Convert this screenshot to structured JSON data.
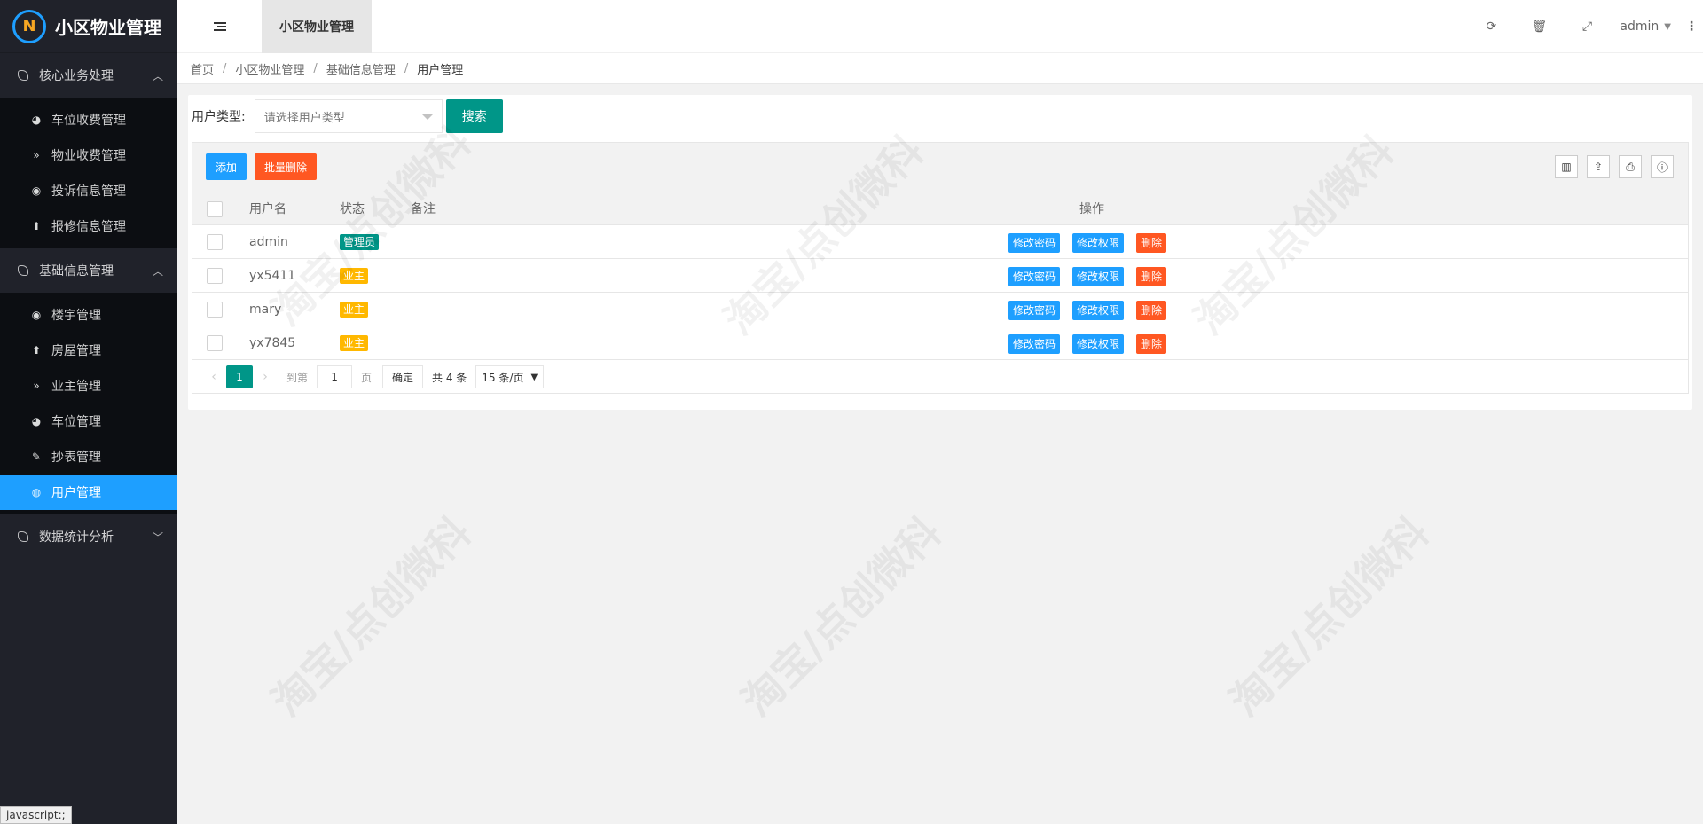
{
  "app": {
    "title": "小区物业管理",
    "logo_letter": "N"
  },
  "sidebar": {
    "groups": [
      {
        "label": "核心业务处理",
        "expanded": true,
        "items": [
          {
            "label": "车位收费管理",
            "icon": "dashboard-icon"
          },
          {
            "label": "物业收费管理",
            "icon": "double-chevron-icon"
          },
          {
            "label": "投诉信息管理",
            "icon": "target-icon"
          },
          {
            "label": "报修信息管理",
            "icon": "circle-up-icon"
          }
        ]
      },
      {
        "label": "基础信息管理",
        "expanded": true,
        "items": [
          {
            "label": "楼宇管理",
            "icon": "target-icon"
          },
          {
            "label": "房屋管理",
            "icon": "circle-up-icon"
          },
          {
            "label": "业主管理",
            "icon": "double-chevron-icon"
          },
          {
            "label": "车位管理",
            "icon": "dashboard-icon"
          },
          {
            "label": "抄表管理",
            "icon": "edit-icon"
          },
          {
            "label": "用户管理",
            "icon": "user-circle-icon",
            "active": true
          }
        ]
      },
      {
        "label": "数据统计分析",
        "expanded": false,
        "items": []
      }
    ],
    "status_tip": "javascript:;"
  },
  "header": {
    "active_tab": "小区物业管理",
    "user": "admin"
  },
  "breadcrumb": [
    "首页",
    "小区物业管理",
    "基础信息管理",
    "用户管理"
  ],
  "filter": {
    "label": "用户类型:",
    "placeholder": "请选择用户类型",
    "search_label": "搜索"
  },
  "toolbar": {
    "add_label": "添加",
    "batch_delete_label": "批量删除"
  },
  "table": {
    "columns": [
      "用户名",
      "状态",
      "备注",
      "操作"
    ],
    "rows": [
      {
        "username": "admin",
        "status": "管理员",
        "status_type": "admin"
      },
      {
        "username": "yx5411",
        "status": "业主",
        "status_type": "owner"
      },
      {
        "username": "mary",
        "status": "业主",
        "status_type": "owner"
      },
      {
        "username": "yx7845",
        "status": "业主",
        "status_type": "owner"
      }
    ],
    "actions": [
      "修改密码",
      "修改权限",
      "删除"
    ]
  },
  "pager": {
    "current": "1",
    "goto_label": "到第",
    "goto_value": "1",
    "page_unit": "页",
    "confirm_label": "确定",
    "total": "共 4 条",
    "page_size": "15 条/页"
  },
  "watermark": "淘宝/点创微科",
  "colors": {
    "sidebar_bg": "#20222a",
    "accent_blue": "#1e9fff",
    "primary_green": "#009688",
    "danger": "#ff5722",
    "warn": "#ffb800"
  }
}
